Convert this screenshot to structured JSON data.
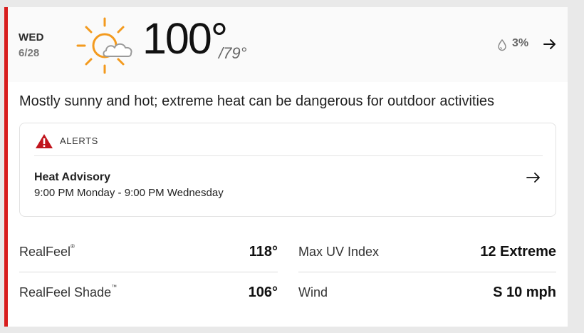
{
  "forecast": {
    "day": "WED",
    "date": "6/28",
    "icon": "partly-sunny-icon",
    "high": "100°",
    "low": "/79°",
    "precip": "3%",
    "summary": "Mostly sunny and hot; extreme heat can be dangerous for outdoor activities"
  },
  "alerts": {
    "label": "ALERTS",
    "title": "Heat Advisory",
    "time": "9:00 PM Monday - 9:00 PM Wednesday"
  },
  "details": {
    "realfeel_label": "RealFeel",
    "realfeel_mark": "®",
    "realfeel_value": "118°",
    "shade_label": "RealFeel Shade",
    "shade_mark": "™",
    "shade_value": "106°",
    "uv_label": "Max UV Index",
    "uv_value": "12 Extreme",
    "wind_label": "Wind",
    "wind_value": "S 10 mph"
  },
  "colors": {
    "accent": "#d81e1e",
    "sun": "#f39a1e",
    "warning": "#c1151d"
  }
}
